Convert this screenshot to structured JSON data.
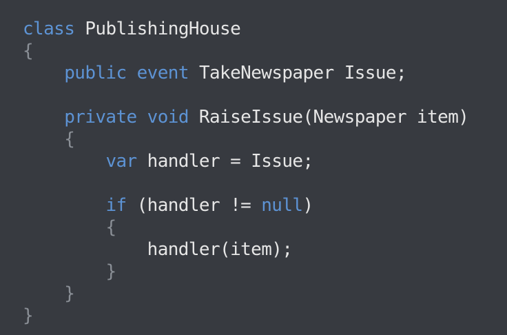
{
  "colors": {
    "background": "#373a40",
    "keyword": "#5d93d4",
    "text": "#e6e6e6",
    "brace": "#8a8f96"
  },
  "code": {
    "l1": {
      "kw": "class",
      "text": " PublishingHouse"
    },
    "l2": {
      "brace": "{"
    },
    "l3": {
      "indent": "    ",
      "kw1": "public",
      "sp": " ",
      "kw2": "event",
      "text": " TakeNewspaper Issue;"
    },
    "l5": {
      "indent": "    ",
      "kw1": "private",
      "sp": " ",
      "kw2": "void",
      "text": " RaiseIssue(Newspaper item)"
    },
    "l6": {
      "indent": "    ",
      "brace": "{"
    },
    "l7": {
      "indent": "        ",
      "kw": "var",
      "text": " handler = Issue;"
    },
    "l9": {
      "indent": "        ",
      "kw1": "if",
      "text1": " (handler != ",
      "kw2": "null",
      "text2": ")"
    },
    "l10": {
      "indent": "        ",
      "brace": "{"
    },
    "l11": {
      "indent": "            ",
      "text": "handler(item);"
    },
    "l12": {
      "indent": "        ",
      "brace": "}"
    },
    "l13": {
      "indent": "    ",
      "brace": "}"
    },
    "l14": {
      "brace": "}"
    }
  }
}
